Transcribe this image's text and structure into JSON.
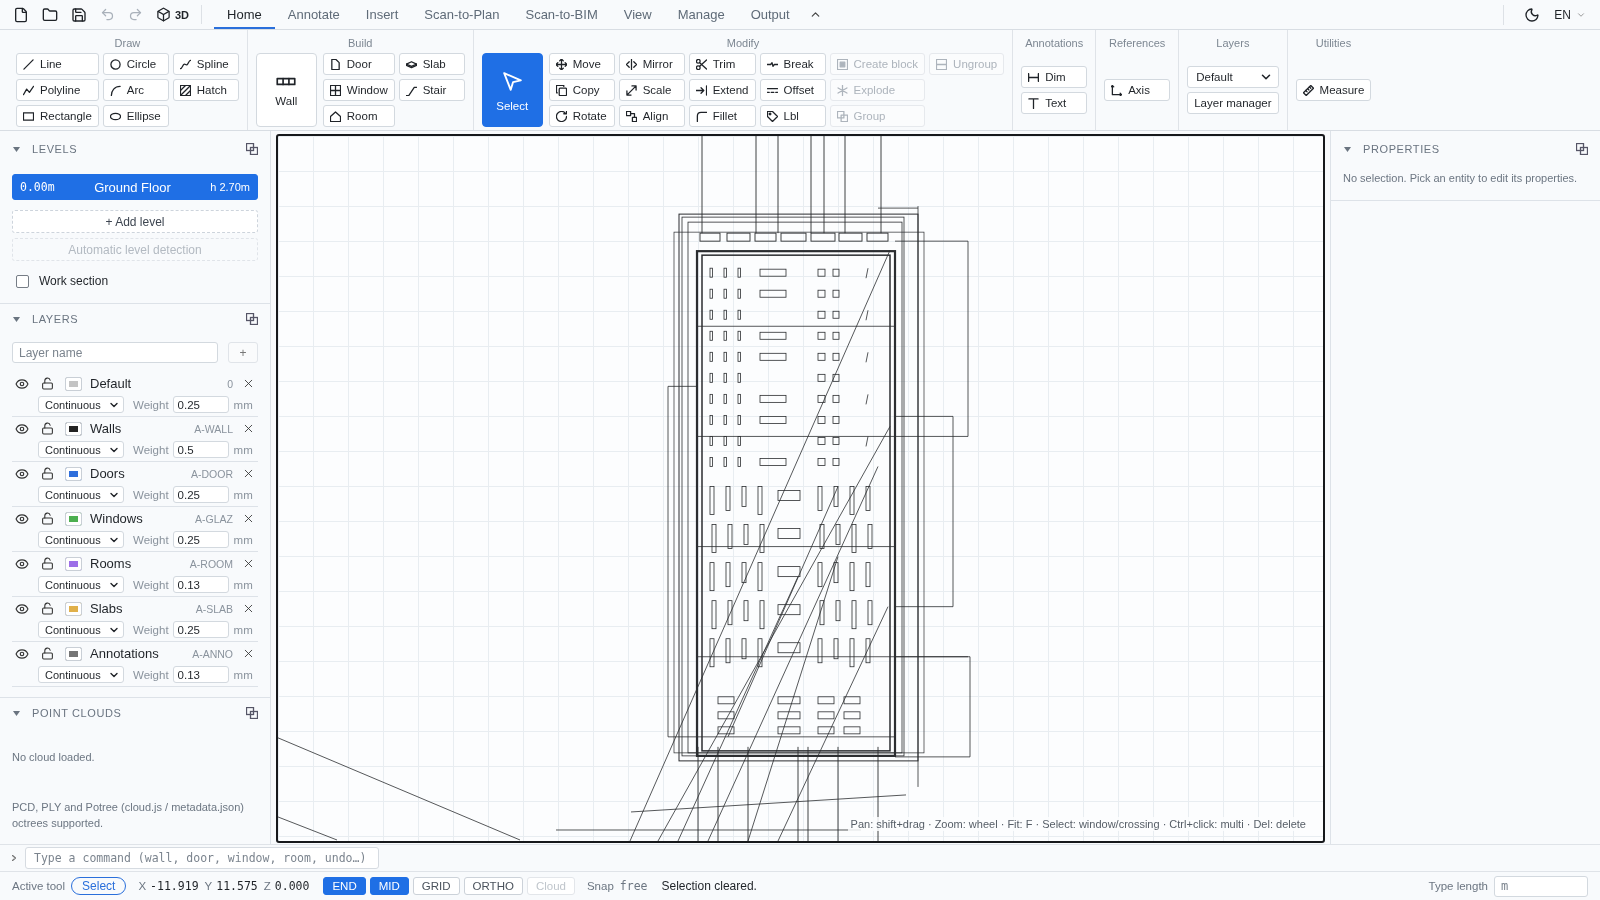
{
  "toolbar": {
    "undo": {
      "disabled": true
    },
    "redo": {
      "disabled": true
    },
    "view_3d": {
      "label": "3D"
    }
  },
  "tabs": [
    {
      "label": "Home",
      "selected": true
    },
    {
      "label": "Annotate",
      "selected": false
    },
    {
      "label": "Insert",
      "selected": false
    },
    {
      "label": "Scan-to-Plan",
      "selected": false
    },
    {
      "label": "Scan-to-BIM",
      "selected": false
    },
    {
      "label": "View",
      "selected": false
    },
    {
      "label": "Manage",
      "selected": false
    },
    {
      "label": "Output",
      "selected": false
    }
  ],
  "language": {
    "label": "EN"
  },
  "ribbon": [
    {
      "title": "Draw",
      "rows": [
        [
          {
            "label": "Line",
            "disabled": false
          },
          {
            "label": "Circle",
            "disabled": false
          },
          {
            "label": "Spline",
            "disabled": false
          }
        ],
        [
          {
            "label": "Polyline",
            "disabled": false
          },
          {
            "label": "Arc",
            "disabled": false
          },
          {
            "label": "Hatch",
            "disabled": false
          }
        ],
        [
          {
            "label": "Rectangle",
            "disabled": false
          },
          {
            "label": "Ellipse",
            "disabled": false
          }
        ]
      ]
    },
    {
      "title": "Build",
      "large": {
        "label": "Wall",
        "selected": false
      },
      "rows": [
        [
          {
            "label": "Door",
            "disabled": false
          },
          {
            "label": "Slab",
            "disabled": false
          }
        ],
        [
          {
            "label": "Window",
            "disabled": false
          },
          {
            "label": "Stair",
            "disabled": false
          }
        ],
        [
          {
            "label": "Room",
            "disabled": false
          }
        ]
      ]
    },
    {
      "title": "Modify",
      "large": {
        "label": "Select",
        "selected": true
      },
      "rows": [
        [
          {
            "label": "Move",
            "disabled": false
          },
          {
            "label": "Mirror",
            "disabled": false
          },
          {
            "label": "Trim",
            "disabled": false
          },
          {
            "label": "Break",
            "disabled": false
          },
          {
            "label": "Create block",
            "disabled": true
          },
          {
            "label": "Ungroup",
            "disabled": true
          }
        ],
        [
          {
            "label": "Copy",
            "disabled": false
          },
          {
            "label": "Scale",
            "disabled": false
          },
          {
            "label": "Extend",
            "disabled": false
          },
          {
            "label": "Offset",
            "disabled": false
          },
          {
            "label": "Explode",
            "disabled": true
          }
        ],
        [
          {
            "label": "Rotate",
            "disabled": false
          },
          {
            "label": "Align",
            "disabled": false
          },
          {
            "label": "Fillet",
            "disabled": false
          },
          {
            "label": "Lbl",
            "disabled": false
          },
          {
            "label": "Group",
            "disabled": true
          }
        ]
      ]
    },
    {
      "title": "Annotations",
      "rows": [
        [
          {
            "label": "Dim",
            "disabled": false
          }
        ],
        [
          {
            "label": "Text",
            "disabled": false
          }
        ]
      ]
    },
    {
      "title": "References",
      "rows": [
        [
          {
            "label": "Axis",
            "disabled": false
          }
        ]
      ]
    },
    {
      "title": "Layers",
      "dropdown": {
        "value": "Default"
      },
      "rows": [
        [
          {
            "label": "Layer manager",
            "disabled": false
          }
        ]
      ]
    },
    {
      "title": "Utilities",
      "rows": [
        [
          {
            "label": "Measure",
            "disabled": false
          }
        ]
      ]
    }
  ],
  "levels_panel": {
    "title": "LEVELS",
    "expanded": true,
    "levels": [
      {
        "elevation": "0.00m",
        "name": "Ground Floor",
        "height": "h 2.70m",
        "selected": true
      }
    ],
    "add_button": "+ Add level",
    "detect_button": {
      "label": "Automatic level detection",
      "disabled": true
    },
    "work_section": {
      "label": "Work section",
      "checked": false
    }
  },
  "layers_panel": {
    "title": "LAYERS",
    "expanded": true,
    "name_field": {
      "placeholder": "Layer name"
    },
    "add_button": "+",
    "layers": [
      {
        "name": "Default",
        "code": "0",
        "color": "#c4c4c4",
        "visible": true,
        "locked": false,
        "linetype": "Continuous",
        "weight_label": "Weight",
        "weight": "0.25",
        "unit": "mm"
      },
      {
        "name": "Walls",
        "code": "A-WALL",
        "color": "#222222",
        "visible": true,
        "locked": false,
        "linetype": "Continuous",
        "weight_label": "Weight",
        "weight": "0.5",
        "unit": "mm"
      },
      {
        "name": "Doors",
        "code": "A-DOOR",
        "color": "#2f6fdc",
        "visible": true,
        "locked": false,
        "linetype": "Continuous",
        "weight_label": "Weight",
        "weight": "0.25",
        "unit": "mm"
      },
      {
        "name": "Windows",
        "code": "A-GLAZ",
        "color": "#4caf50",
        "visible": true,
        "locked": false,
        "linetype": "Continuous",
        "weight_label": "Weight",
        "weight": "0.25",
        "unit": "mm"
      },
      {
        "name": "Rooms",
        "code": "A-ROOM",
        "color": "#9d6fe8",
        "visible": true,
        "locked": false,
        "linetype": "Continuous",
        "weight_label": "Weight",
        "weight": "0.13",
        "unit": "mm"
      },
      {
        "name": "Slabs",
        "code": "A-SLAB",
        "color": "#e0b04a",
        "visible": true,
        "locked": false,
        "linetype": "Continuous",
        "weight_label": "Weight",
        "weight": "0.25",
        "unit": "mm"
      },
      {
        "name": "Annotations",
        "code": "A-ANNO",
        "color": "#757575",
        "visible": true,
        "locked": false,
        "linetype": "Continuous",
        "weight_label": "Weight",
        "weight": "0.13",
        "unit": "mm"
      }
    ]
  },
  "point_clouds_panel": {
    "title": "POINT CLOUDS",
    "expanded": true,
    "empty_message": "No cloud loaded.",
    "note": "PCD, PLY and Potree (cloud.js / metadata.json) octrees supported."
  },
  "canvas": {
    "hint": "Pan: shift+drag · Zoom: wheel · Fit: F · Select: window/crossing · Ctrl+click: multi · Del: delete"
  },
  "properties_panel": {
    "title": "PROPERTIES",
    "expanded": true,
    "message": "No selection. Pick an entity to edit its properties."
  },
  "command_line": {
    "placeholder": "Type a command (wall, door, window, room, undo…)"
  },
  "status_bar": {
    "active_tool_label": "Active tool",
    "active_tool": "Select",
    "coordinates": [
      {
        "axis": "X",
        "value": "-11.919"
      },
      {
        "axis": "Y",
        "value": "11.575"
      },
      {
        "axis": "Z",
        "value": "0.000"
      }
    ],
    "snaps": [
      {
        "label": "END",
        "on": true,
        "disabled": false
      },
      {
        "label": "MID",
        "on": true,
        "disabled": false
      },
      {
        "label": "GRID",
        "on": false,
        "disabled": false
      },
      {
        "label": "ORTHO",
        "on": false,
        "disabled": false
      },
      {
        "label": "Cloud",
        "on": false,
        "disabled": true
      }
    ],
    "snap_label": "Snap",
    "snap_mode": "free",
    "message": "Selection cleared.",
    "length_label": "Type length",
    "length_field": {
      "placeholder": "m"
    }
  }
}
